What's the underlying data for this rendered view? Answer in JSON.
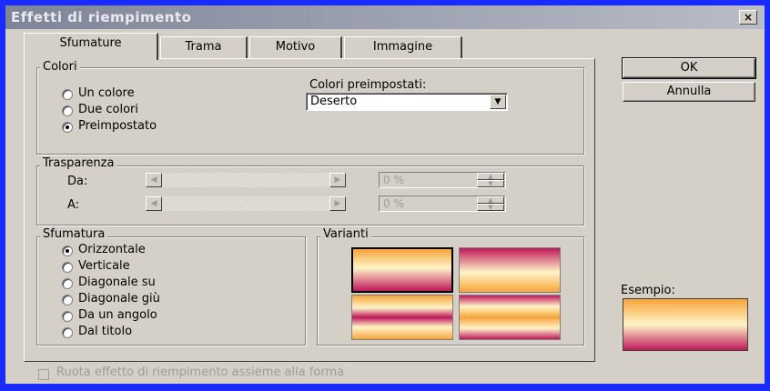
{
  "window": {
    "title": "Effetti di riempimento",
    "close_label": "×"
  },
  "tabs": [
    "Sfumature",
    "Trama",
    "Motivo",
    "Immagine"
  ],
  "colori": {
    "legend": "Colori",
    "options": [
      "Un colore",
      "Due colori",
      "Preimpostato"
    ],
    "selected": "Preimpostato",
    "preset_label": "Colori preimpostati:",
    "preset_value": "Deserto"
  },
  "trasparenza": {
    "legend": "Trasparenza",
    "da_label": "Da:",
    "a_label": "A:",
    "da_value": "0 %",
    "a_value": "0 %"
  },
  "sfumatura": {
    "legend": "Sfumatura",
    "options": [
      "Orizzontale",
      "Verticale",
      "Diagonale su",
      "Diagonale giù",
      "Da un angolo",
      "Dal titolo"
    ],
    "selected": "Orizzontale"
  },
  "varianti": {
    "legend": "Varianti"
  },
  "buttons": {
    "ok": "OK",
    "cancel": "Annulla"
  },
  "esempio": {
    "label": "Esempio:"
  },
  "checkbox": {
    "label": "Ruota effetto di riempimento assieme alla forma",
    "checked": false
  },
  "colors": {
    "desert_top": "#f7a43a",
    "desert_mid": "#fff4c8",
    "desert_bottom": "#c0185a"
  }
}
